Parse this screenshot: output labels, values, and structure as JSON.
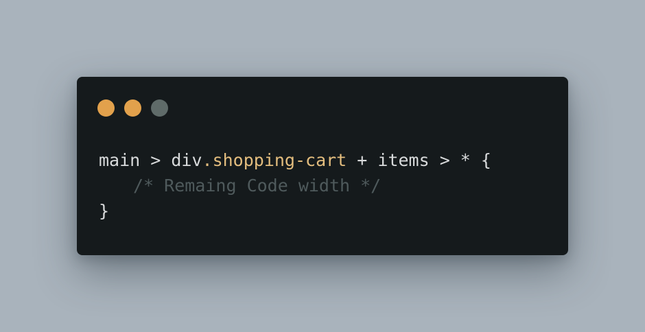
{
  "window": {
    "controls": [
      {
        "name": "close",
        "color": "#e2a14c"
      },
      {
        "name": "minimize",
        "color": "#e2a14c"
      },
      {
        "name": "maximize",
        "color": "#5f6b69"
      }
    ]
  },
  "code": {
    "line1": {
      "selector_start": "main > div",
      "class_token": ".shopping-cart",
      "selector_end": " + items > * {"
    },
    "line2": {
      "comment": "/* Remaing Code width */"
    },
    "line3": {
      "close": "}"
    }
  },
  "colors": {
    "background": "#a9b3bc",
    "editor": "#151a1c",
    "text": "#d8dadb",
    "class_token": "#e3bd7e",
    "comment": "#4f5a5c"
  }
}
